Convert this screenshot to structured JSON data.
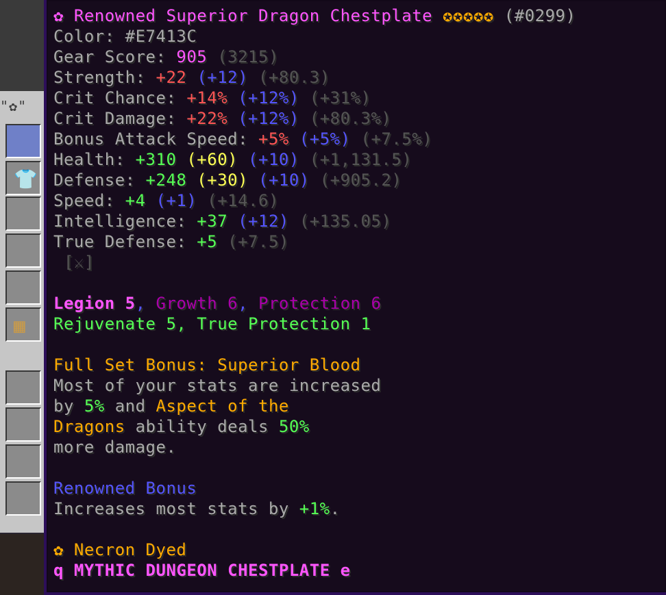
{
  "inventory": {
    "title": "\"✿\""
  },
  "tooltip": {
    "header": {
      "icon": "✿",
      "name": "Renowned Superior Dragon Chestplate",
      "stars": "✪✪✪✪✪",
      "id": "(#0299)"
    },
    "color_line": {
      "label": "Color: ",
      "value": "#E7413C"
    },
    "gear_score": {
      "label": "Gear Score: ",
      "value": "905",
      "extra": "(3215)"
    },
    "stats": [
      {
        "label": "Strength: ",
        "value": "+22",
        "reforge": "(+12)",
        "dungeon": "(+80.3)"
      },
      {
        "label": "Crit Chance: ",
        "value": "+14%",
        "reforge": "(+12%)",
        "dungeon": "(+31%)"
      },
      {
        "label": "Crit Damage: ",
        "value": "+22%",
        "reforge": "(+12%)",
        "dungeon": "(+80.3%)"
      },
      {
        "label": "Bonus Attack Speed: ",
        "value": "+5%",
        "reforge": "(+5%)",
        "dungeon": "(+7.5%)"
      }
    ],
    "health": {
      "label": "Health: ",
      "value": "+310",
      "gem": "(+60)",
      "reforge": "(+10)",
      "dungeon": "(+1,131.5)"
    },
    "defense": {
      "label": "Defense: ",
      "value": "+248",
      "gem": "(+30)",
      "reforge": "(+10)",
      "dungeon": "(+905.2)"
    },
    "speed": {
      "label": "Speed: ",
      "value": "+4",
      "reforge": "(+1)",
      "dungeon": "(+14.6)"
    },
    "intelligence": {
      "label": "Intelligence: ",
      "value": "+37",
      "reforge": "(+12)",
      "dungeon": "(+135.05)"
    },
    "true_defense": {
      "label": "True Defense: ",
      "value": "+5",
      "dungeon": "(+7.5)"
    },
    "gem_slot": "[⚔]",
    "enchants_1": {
      "legion": "Legion 5",
      "sep1": ", ",
      "growth": "Growth 6",
      "sep2": ", ",
      "protection": "Protection 6"
    },
    "enchants_2": {
      "text": "Rejuvenate 5, True Protection 1"
    },
    "set_bonus": {
      "title": "Full Set Bonus: Superior Blood",
      "line1": "Most of your stats are increased",
      "line2_a": "by ",
      "line2_b": "5%",
      "line2_c": " and ",
      "line2_d": "Aspect of the",
      "line3_a": "Dragons",
      "line3_b": " ability deals ",
      "line3_c": "50%",
      "line4": "more damage."
    },
    "renowned": {
      "title": "Renowned Bonus",
      "text_a": "Increases most stats by ",
      "text_b": "+1%",
      "text_c": "."
    },
    "dyed": {
      "icon": "✿",
      "text": "Necron Dyed"
    },
    "rarity": {
      "left": "q",
      "text": "MYTHIC DUNGEON CHESTPLATE",
      "right": "e"
    }
  },
  "colors": {
    "pink": "#ff55ff",
    "gray": "#aaaaaa",
    "dark_gray": "#555555",
    "red": "#ff5555",
    "blue": "#5555ff",
    "green": "#55ff55",
    "yellow": "#ffff55",
    "gold": "#ffaa00",
    "purple": "#aa00aa",
    "tooltip_bg": "#160b1c",
    "tooltip_border": "#2d0f5a"
  }
}
